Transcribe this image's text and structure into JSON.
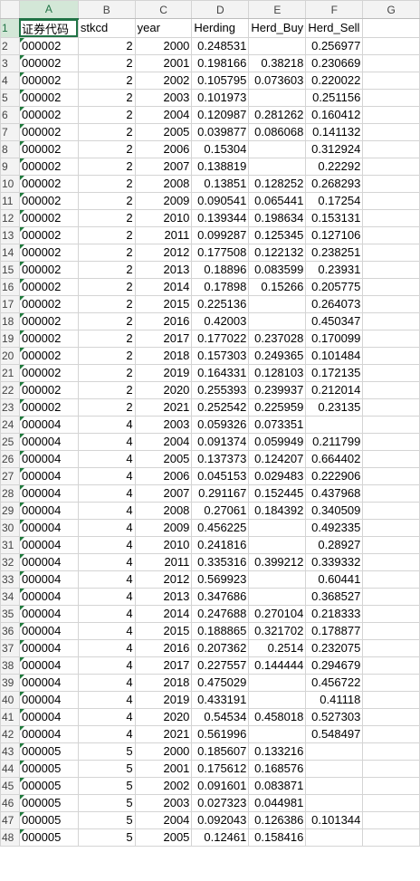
{
  "columns": [
    "A",
    "B",
    "C",
    "D",
    "E",
    "F",
    "G"
  ],
  "selected_column": "A",
  "header_row": {
    "row": "1",
    "cells": [
      "证券代码",
      "stkcd",
      "year",
      "Herding",
      "Herd_Buy",
      "Herd_Sell",
      ""
    ]
  },
  "rows": [
    {
      "row": "2",
      "cells": [
        "000002",
        "2",
        "2000",
        "0.248531",
        "",
        "0.256977",
        ""
      ]
    },
    {
      "row": "3",
      "cells": [
        "000002",
        "2",
        "2001",
        "0.198166",
        "0.38218",
        "0.230669",
        ""
      ]
    },
    {
      "row": "4",
      "cells": [
        "000002",
        "2",
        "2002",
        "0.105795",
        "0.073603",
        "0.220022",
        ""
      ]
    },
    {
      "row": "5",
      "cells": [
        "000002",
        "2",
        "2003",
        "0.101973",
        "",
        "0.251156",
        ""
      ]
    },
    {
      "row": "6",
      "cells": [
        "000002",
        "2",
        "2004",
        "0.120987",
        "0.281262",
        "0.160412",
        ""
      ]
    },
    {
      "row": "7",
      "cells": [
        "000002",
        "2",
        "2005",
        "0.039877",
        "0.086068",
        "0.141132",
        ""
      ]
    },
    {
      "row": "8",
      "cells": [
        "000002",
        "2",
        "2006",
        "0.15304",
        "",
        "0.312924",
        ""
      ]
    },
    {
      "row": "9",
      "cells": [
        "000002",
        "2",
        "2007",
        "0.138819",
        "",
        "0.22292",
        ""
      ]
    },
    {
      "row": "10",
      "cells": [
        "000002",
        "2",
        "2008",
        "0.13851",
        "0.128252",
        "0.268293",
        ""
      ]
    },
    {
      "row": "11",
      "cells": [
        "000002",
        "2",
        "2009",
        "0.090541",
        "0.065441",
        "0.17254",
        ""
      ]
    },
    {
      "row": "12",
      "cells": [
        "000002",
        "2",
        "2010",
        "0.139344",
        "0.198634",
        "0.153131",
        ""
      ]
    },
    {
      "row": "13",
      "cells": [
        "000002",
        "2",
        "2011",
        "0.099287",
        "0.125345",
        "0.127106",
        ""
      ]
    },
    {
      "row": "14",
      "cells": [
        "000002",
        "2",
        "2012",
        "0.177508",
        "0.122132",
        "0.238251",
        ""
      ]
    },
    {
      "row": "15",
      "cells": [
        "000002",
        "2",
        "2013",
        "0.18896",
        "0.083599",
        "0.23931",
        ""
      ]
    },
    {
      "row": "16",
      "cells": [
        "000002",
        "2",
        "2014",
        "0.17898",
        "0.15266",
        "0.205775",
        ""
      ]
    },
    {
      "row": "17",
      "cells": [
        "000002",
        "2",
        "2015",
        "0.225136",
        "",
        "0.264073",
        ""
      ]
    },
    {
      "row": "18",
      "cells": [
        "000002",
        "2",
        "2016",
        "0.42003",
        "",
        "0.450347",
        ""
      ]
    },
    {
      "row": "19",
      "cells": [
        "000002",
        "2",
        "2017",
        "0.177022",
        "0.237028",
        "0.170099",
        ""
      ]
    },
    {
      "row": "20",
      "cells": [
        "000002",
        "2",
        "2018",
        "0.157303",
        "0.249365",
        "0.101484",
        ""
      ]
    },
    {
      "row": "21",
      "cells": [
        "000002",
        "2",
        "2019",
        "0.164331",
        "0.128103",
        "0.172135",
        ""
      ]
    },
    {
      "row": "22",
      "cells": [
        "000002",
        "2",
        "2020",
        "0.255393",
        "0.239937",
        "0.212014",
        ""
      ]
    },
    {
      "row": "23",
      "cells": [
        "000002",
        "2",
        "2021",
        "0.252542",
        "0.225959",
        "0.23135",
        ""
      ]
    },
    {
      "row": "24",
      "cells": [
        "000004",
        "4",
        "2003",
        "0.059326",
        "0.073351",
        "",
        ""
      ]
    },
    {
      "row": "25",
      "cells": [
        "000004",
        "4",
        "2004",
        "0.091374",
        "0.059949",
        "0.211799",
        ""
      ]
    },
    {
      "row": "26",
      "cells": [
        "000004",
        "4",
        "2005",
        "0.137373",
        "0.124207",
        "0.664402",
        ""
      ]
    },
    {
      "row": "27",
      "cells": [
        "000004",
        "4",
        "2006",
        "0.045153",
        "0.029483",
        "0.222906",
        ""
      ]
    },
    {
      "row": "28",
      "cells": [
        "000004",
        "4",
        "2007",
        "0.291167",
        "0.152445",
        "0.437968",
        ""
      ]
    },
    {
      "row": "29",
      "cells": [
        "000004",
        "4",
        "2008",
        "0.27061",
        "0.184392",
        "0.340509",
        ""
      ]
    },
    {
      "row": "30",
      "cells": [
        "000004",
        "4",
        "2009",
        "0.456225",
        "",
        "0.492335",
        ""
      ]
    },
    {
      "row": "31",
      "cells": [
        "000004",
        "4",
        "2010",
        "0.241816",
        "",
        "0.28927",
        ""
      ]
    },
    {
      "row": "32",
      "cells": [
        "000004",
        "4",
        "2011",
        "0.335316",
        "0.399212",
        "0.339332",
        ""
      ]
    },
    {
      "row": "33",
      "cells": [
        "000004",
        "4",
        "2012",
        "0.569923",
        "",
        "0.60441",
        ""
      ]
    },
    {
      "row": "34",
      "cells": [
        "000004",
        "4",
        "2013",
        "0.347686",
        "",
        "0.368527",
        ""
      ]
    },
    {
      "row": "35",
      "cells": [
        "000004",
        "4",
        "2014",
        "0.247688",
        "0.270104",
        "0.218333",
        ""
      ]
    },
    {
      "row": "36",
      "cells": [
        "000004",
        "4",
        "2015",
        "0.188865",
        "0.321702",
        "0.178877",
        ""
      ]
    },
    {
      "row": "37",
      "cells": [
        "000004",
        "4",
        "2016",
        "0.207362",
        "0.2514",
        "0.232075",
        ""
      ]
    },
    {
      "row": "38",
      "cells": [
        "000004",
        "4",
        "2017",
        "0.227557",
        "0.144444",
        "0.294679",
        ""
      ]
    },
    {
      "row": "39",
      "cells": [
        "000004",
        "4",
        "2018",
        "0.475029",
        "",
        "0.456722",
        ""
      ]
    },
    {
      "row": "40",
      "cells": [
        "000004",
        "4",
        "2019",
        "0.433191",
        "",
        "0.41118",
        ""
      ]
    },
    {
      "row": "41",
      "cells": [
        "000004",
        "4",
        "2020",
        "0.54534",
        "0.458018",
        "0.527303",
        ""
      ]
    },
    {
      "row": "42",
      "cells": [
        "000004",
        "4",
        "2021",
        "0.561996",
        "",
        "0.548497",
        ""
      ]
    },
    {
      "row": "43",
      "cells": [
        "000005",
        "5",
        "2000",
        "0.185607",
        "0.133216",
        "",
        ""
      ]
    },
    {
      "row": "44",
      "cells": [
        "000005",
        "5",
        "2001",
        "0.175612",
        "0.168576",
        "",
        ""
      ]
    },
    {
      "row": "45",
      "cells": [
        "000005",
        "5",
        "2002",
        "0.091601",
        "0.083871",
        "",
        ""
      ]
    },
    {
      "row": "46",
      "cells": [
        "000005",
        "5",
        "2003",
        "0.027323",
        "0.044981",
        "",
        ""
      ]
    },
    {
      "row": "47",
      "cells": [
        "000005",
        "5",
        "2004",
        "0.092043",
        "0.126386",
        "0.101344",
        ""
      ]
    },
    {
      "row": "48",
      "cells": [
        "000005",
        "5",
        "2005",
        "0.12461",
        "0.158416",
        "",
        ""
      ]
    }
  ]
}
